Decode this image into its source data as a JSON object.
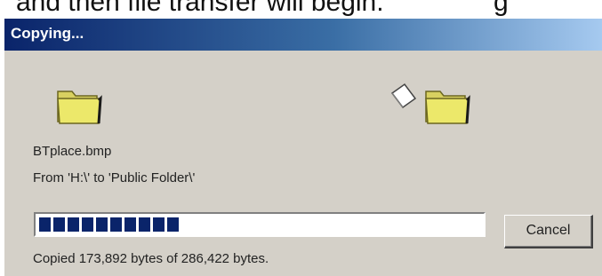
{
  "doc_text": "and then file transfer will begin.",
  "doc_text_tail": "g",
  "dialog": {
    "title": "Copying...",
    "file_name": "BTplace.bmp",
    "from_line": "From 'H:\\' to 'Public Folder\\'",
    "progress_fraction": 0.34,
    "cancel_label": "Cancel",
    "status": "Copied 173,892 bytes of 286,422 bytes."
  },
  "icons": {
    "source": "folder-icon",
    "destination": "folder-icon",
    "moving_document": "document-icon"
  },
  "colors": {
    "title_gradient_start": "#0a246a",
    "title_gradient_end": "#a6caf0",
    "dialog_face": "#d4d0c8",
    "progress_block": "#0a246a",
    "folder_yellow": "#ece86a"
  }
}
